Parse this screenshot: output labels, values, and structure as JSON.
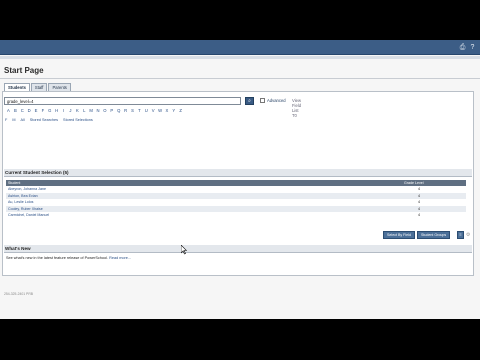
{
  "topbar": {
    "icons": [
      "print-icon",
      "help-icon"
    ]
  },
  "page": {
    "title": "Start Page"
  },
  "tabs": [
    {
      "label": "Students",
      "active": true
    },
    {
      "label": "Staff",
      "active": false
    },
    {
      "label": "Parents",
      "active": false
    }
  ],
  "search": {
    "value": "grade_level=4",
    "advanced_label": "Advanced",
    "find_label": "View Field List",
    "find_count": "T0"
  },
  "letters": [
    "A",
    "B",
    "C",
    "D",
    "E",
    "F",
    "G",
    "H",
    "I",
    "J",
    "K",
    "L",
    "M",
    "N",
    "O",
    "P",
    "Q",
    "R",
    "S",
    "T",
    "U",
    "V",
    "W",
    "X",
    "Y",
    "Z"
  ],
  "recent": {
    "items": [
      "F",
      "M",
      "All",
      "Stored Searches",
      "Stored Selections"
    ]
  },
  "selection": {
    "title": "Current Student Selection (5)",
    "columns": [
      "Student",
      "Grade Level"
    ],
    "rows": [
      {
        "name": "Abeyron, Johanna Jane",
        "grade": "4"
      },
      {
        "name": "Ashton, Bea Evian",
        "grade": "4"
      },
      {
        "name": "Au, Leslie Lolos",
        "grade": "4"
      },
      {
        "name": "Cooley, Ruber Xhaise",
        "grade": "4"
      },
      {
        "name": "Carmichel, Daniel Manuel",
        "grade": "4"
      }
    ],
    "actions": [
      "Select By Field",
      "Student Groups"
    ]
  },
  "whats_new": {
    "title": "What's New",
    "text": "See what's new in the latest feature release of PowerSchool.",
    "link": "Read more..."
  },
  "footer": {
    "text": "254-325-2401 PRB"
  }
}
